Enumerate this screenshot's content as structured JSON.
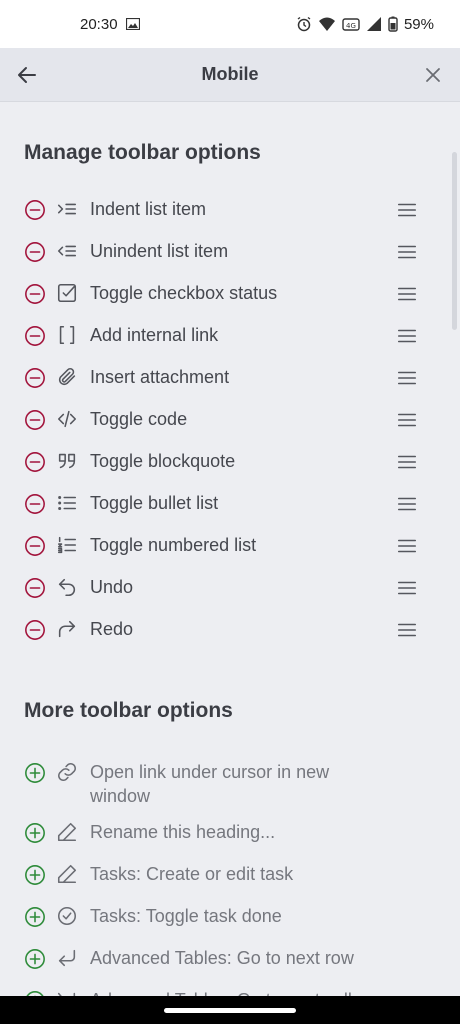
{
  "status": {
    "time": "20:30",
    "battery": "59%"
  },
  "header": {
    "title": "Mobile"
  },
  "sections": {
    "manage_title": "Manage toolbar options",
    "more_title": "More toolbar options"
  },
  "manage_items": [
    {
      "label": "Indent list item",
      "icon": "indent-icon"
    },
    {
      "label": "Unindent list item",
      "icon": "unindent-icon"
    },
    {
      "label": "Toggle checkbox status",
      "icon": "checkbox-icon"
    },
    {
      "label": "Add internal link",
      "icon": "brackets-icon"
    },
    {
      "label": "Insert attachment",
      "icon": "paperclip-icon"
    },
    {
      "label": "Toggle code",
      "icon": "code-icon"
    },
    {
      "label": "Toggle blockquote",
      "icon": "quote-icon"
    },
    {
      "label": "Toggle bullet list",
      "icon": "bullet-list-icon"
    },
    {
      "label": "Toggle numbered list",
      "icon": "numbered-list-icon"
    },
    {
      "label": "Undo",
      "icon": "undo-icon"
    },
    {
      "label": "Redo",
      "icon": "redo-icon"
    }
  ],
  "more_items": [
    {
      "label": "Open link under cursor in new window",
      "icon": "link-icon"
    },
    {
      "label": "Rename this heading...",
      "icon": "pencil-icon"
    },
    {
      "label": "Tasks: Create or edit task",
      "icon": "pencil-icon"
    },
    {
      "label": "Tasks: Toggle task done",
      "icon": "check-circle-icon"
    },
    {
      "label": "Advanced Tables: Go to next row",
      "icon": "enter-icon"
    },
    {
      "label": "Advanced Tables: Go to next cell",
      "icon": "tab-icon"
    }
  ],
  "colors": {
    "remove": "#a2143c",
    "add": "#2e8b3a",
    "text": "#45474e",
    "muted": "#75777e"
  }
}
